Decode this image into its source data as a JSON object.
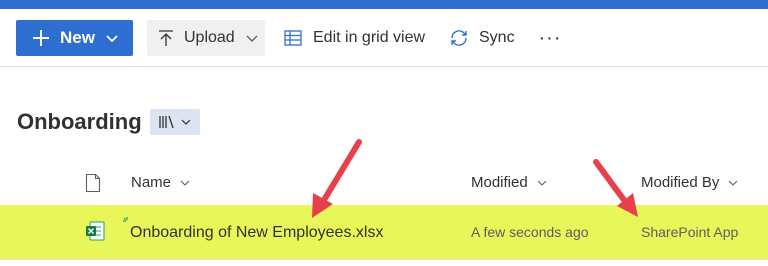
{
  "colors": {
    "accent": "#2f6ed1",
    "highlight": "#e8f65a",
    "annotation_arrow": "#e8404a"
  },
  "toolbar": {
    "new_label": "New",
    "upload_label": "Upload",
    "grid_label": "Edit in grid view",
    "sync_label": "Sync",
    "more_label": "···"
  },
  "library": {
    "title": "Onboarding"
  },
  "columns": {
    "name": "Name",
    "modified": "Modified",
    "modified_by": "Modified By"
  },
  "rows": [
    {
      "name": "Onboarding of New Employees.xlsx",
      "modified": "A few seconds ago",
      "modified_by": "SharePoint App",
      "icon": "excel-icon"
    }
  ]
}
